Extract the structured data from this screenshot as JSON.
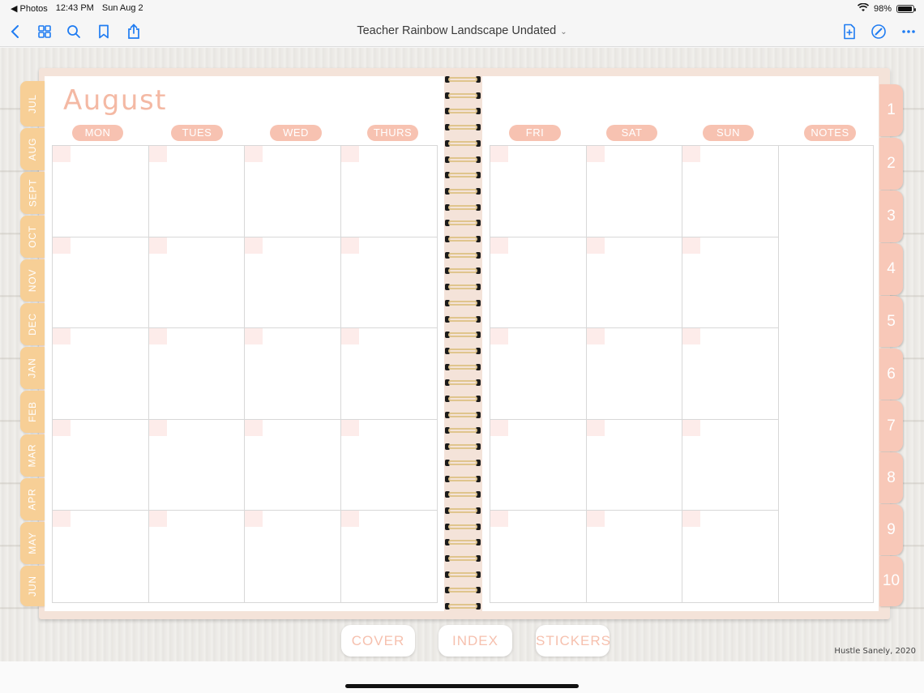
{
  "status_bar": {
    "back_app": "◀ Photos",
    "time": "12:43 PM",
    "date": "Sun Aug 2",
    "battery": "98%",
    "battery_level": 0.98
  },
  "toolbar": {
    "title": "Teacher Rainbow Landscape Undated"
  },
  "planner": {
    "month": "August",
    "left_days": [
      "MON",
      "TUES",
      "WED",
      "THURS"
    ],
    "right_days": [
      "FRI",
      "SAT",
      "SUN",
      "NOTES"
    ],
    "month_tabs": [
      "JUL",
      "AUG",
      "SEPT",
      "OCT",
      "NOV",
      "DEC",
      "JAN",
      "FEB",
      "MAR",
      "APR",
      "MAY",
      "JUN"
    ],
    "number_tabs": [
      "1",
      "2",
      "3",
      "4",
      "5",
      "6",
      "7",
      "8",
      "9",
      "10"
    ],
    "bottom_buttons": [
      "COVER",
      "INDEX",
      "STICKERS"
    ],
    "credit": "Hustle Sanely, 2020"
  },
  "colors": {
    "accent": "#f4b9a4",
    "pill": "#f7c2b1",
    "month_tab": "#f7cf96",
    "number_tab": "#f8c8b8",
    "system_blue": "#1f7cf2"
  }
}
